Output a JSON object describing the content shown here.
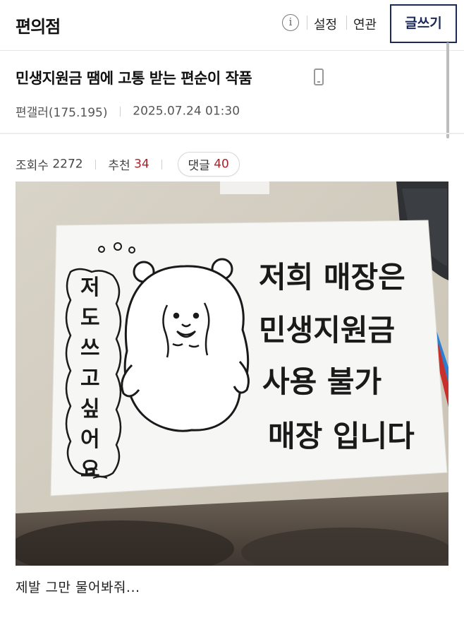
{
  "header": {
    "gallery_title": "편의점",
    "info_icon": "info-icon",
    "settings_label": "설정",
    "related_label": "연관",
    "write_label": "글쓰기"
  },
  "post": {
    "title": "민생지원금 땜에 고통 받는 편순이 작품",
    "device_icon": "mobile-icon",
    "author": "편갤러(175.195)",
    "datetime": "2025.07.24 01:30",
    "views_label": "조회수",
    "views": "2272",
    "recommend_label": "추천",
    "recommend": "34",
    "comments_label": "댓글",
    "comments": "40",
    "caption": "제발 그만 물어봐줘..."
  },
  "image": {
    "sign_lines": [
      "저희 매장은",
      "민생지원금",
      "사용 불가",
      "매장 입니다"
    ],
    "side_text": [
      "저",
      "도",
      "쓰",
      "고",
      "싶",
      "어",
      "요"
    ]
  },
  "colors": {
    "accent_navy": "#1b2a5a",
    "count_red": "#a5232a"
  }
}
